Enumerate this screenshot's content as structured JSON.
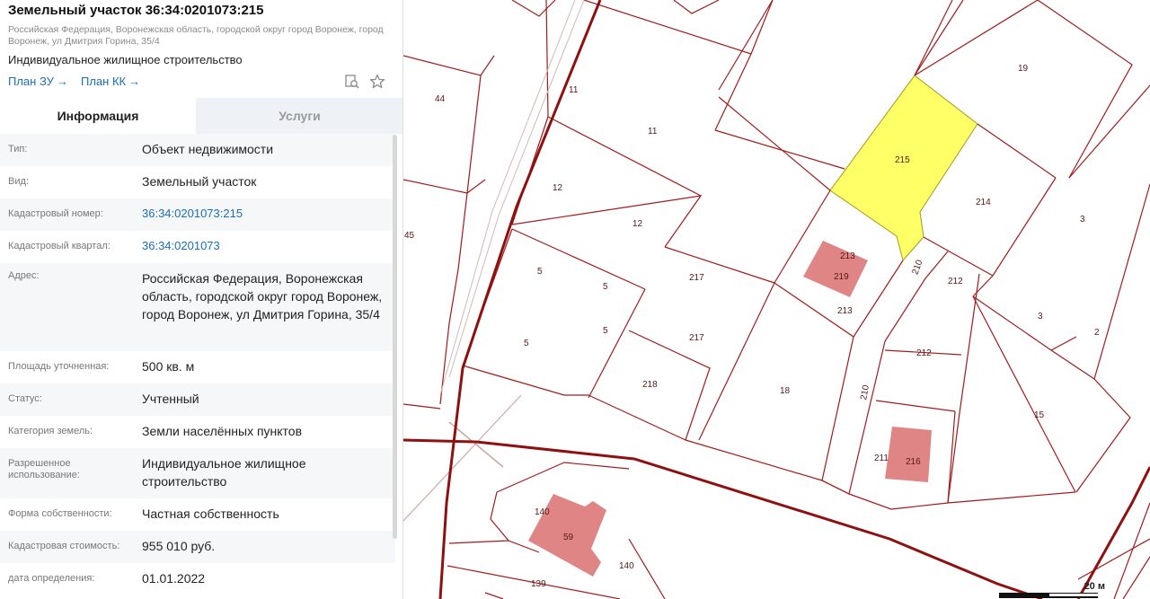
{
  "header": {
    "title": "Земельный участок 36:34:0201073:215",
    "address_line": "Российская Федерация, Воронежская область, городской округ город Воронеж, город Воронеж, ул Дмитрия Горина, 35/4",
    "purpose": "Индивидуальное жилищное строительство",
    "link_plan_zu": "План ЗУ",
    "link_plan_kk": "План КК",
    "arrow": "→",
    "icons": [
      "search-document-icon",
      "star-icon"
    ]
  },
  "tabs": [
    {
      "label": "Информация",
      "active": true
    },
    {
      "label": "Услуги",
      "active": false
    }
  ],
  "rows": [
    {
      "label": "Тип:",
      "value": "Объект недвижимости"
    },
    {
      "label": "Вид:",
      "value": "Земельный участок"
    },
    {
      "label": "Кадастровый номер:",
      "value": "36:34:0201073:215",
      "link": true
    },
    {
      "label": "Кадастровый квартал:",
      "value": "36:34:0201073",
      "link": true
    },
    {
      "label": "Адрес:",
      "value": "Российская Федерация, Воронежская область, городской округ город Воронеж, город Воронеж, ул Дмитрия Горина, 35/4"
    },
    {
      "label": "Площадь уточненная:",
      "value": "500 кв. м"
    },
    {
      "label": "Статус:",
      "value": "Учтенный"
    },
    {
      "label": "Категория земель:",
      "value": "Земли населённых пунктов"
    },
    {
      "label": "Разрешенное использование:",
      "value": "Индивидуальное жилищное строительство"
    },
    {
      "label": "Форма собственности:",
      "value": "Частная собственность"
    },
    {
      "label": "Кадастровая стоимость:",
      "value": "955 010 руб."
    },
    {
      "label": "дата определения:",
      "value": "01.01.2022"
    }
  ],
  "map": {
    "parcel_labels": [
      "44",
      "45",
      "11",
      "11",
      "12",
      "12",
      "5",
      "5",
      "5",
      "5",
      "217",
      "217",
      "218",
      "18",
      "213",
      "219",
      "213",
      "210",
      "210",
      "212",
      "212",
      "211",
      "216",
      "215",
      "214",
      "19",
      "3",
      "3",
      "2",
      "15",
      "140",
      "59",
      "140",
      "139"
    ],
    "selected_parcel": "215",
    "scale_label": "20 м",
    "colors": {
      "boundary": "#a01c1c",
      "thick_boundary": "#8e1010",
      "selected_fill": "#ffff66",
      "building_fill": "#e08585",
      "link": "#1a6fb5"
    }
  }
}
